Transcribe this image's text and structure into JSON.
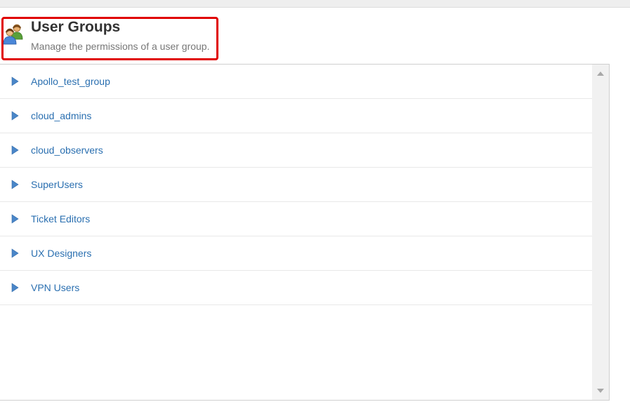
{
  "header": {
    "title": "User Groups",
    "subtitle": "Manage the permissions of a user group.",
    "icon": "user-group-icon",
    "highlight_color": "#e00000"
  },
  "groups": [
    {
      "label": "Apollo_test_group"
    },
    {
      "label": "cloud_admins"
    },
    {
      "label": "cloud_observers"
    },
    {
      "label": "SuperUsers"
    },
    {
      "label": "Ticket Editors"
    },
    {
      "label": "UX Designers"
    },
    {
      "label": "VPN Users"
    }
  ],
  "colors": {
    "link": "#2a6fb0",
    "arrow": "#4a86c8",
    "title": "#333333",
    "subtitle": "#777777"
  }
}
